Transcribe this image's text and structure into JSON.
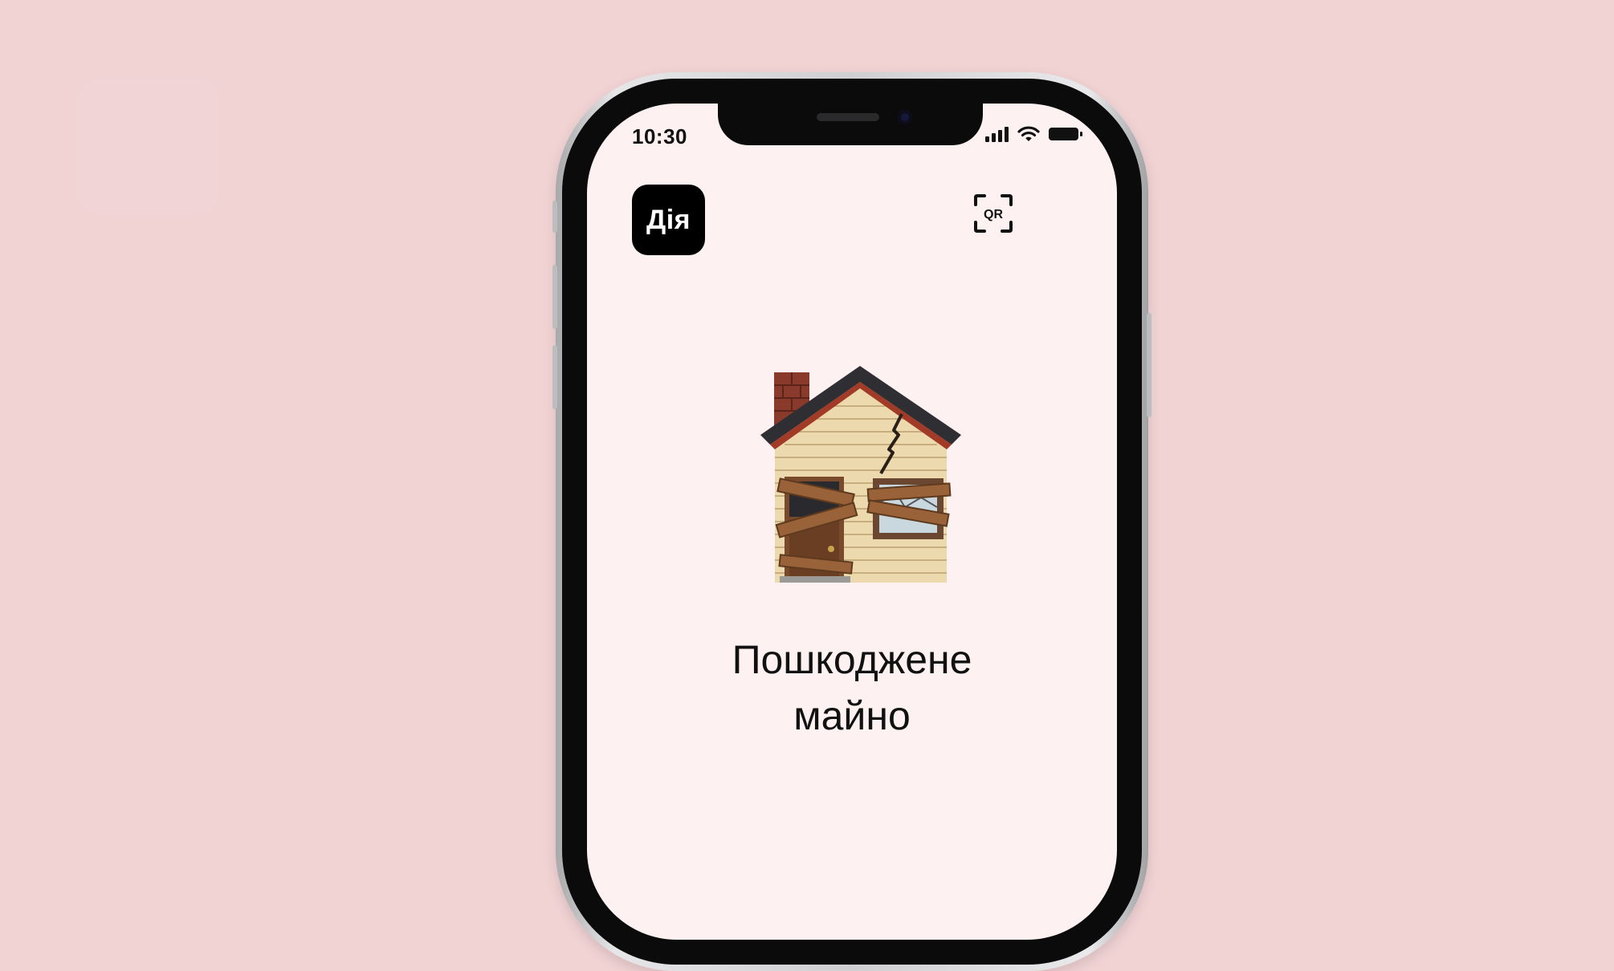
{
  "status_bar": {
    "time": "10:30"
  },
  "app": {
    "logo_text": "Дія",
    "qr_label": "QR"
  },
  "content": {
    "title_line1": "Пошкоджене",
    "title_line2": "майно"
  },
  "icons": {
    "house": "derelict-house-icon",
    "qr": "qr-scan-icon",
    "signal": "cellular-signal-icon",
    "wifi": "wifi-icon",
    "battery": "battery-icon"
  },
  "colors": {
    "background": "#f1d3d4",
    "screen": "#fdf1f1",
    "logo": "#000000"
  }
}
